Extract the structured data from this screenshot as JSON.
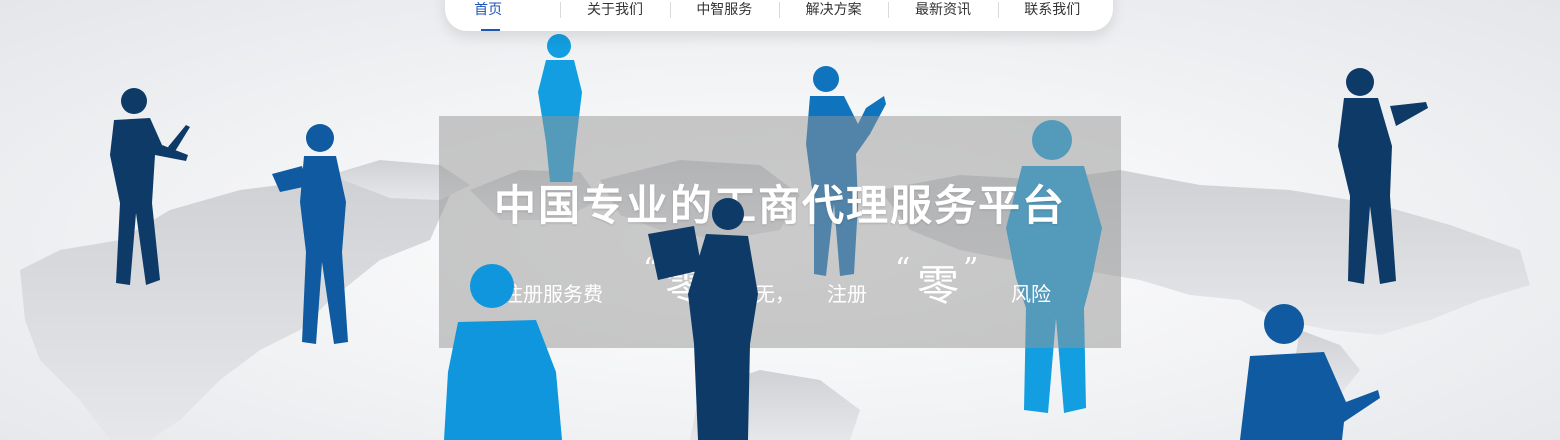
{
  "nav": {
    "items": [
      {
        "label": "首页",
        "active": true
      },
      {
        "label": "关于我们",
        "active": false
      },
      {
        "label": "中智服务",
        "active": false
      },
      {
        "label": "解决方案",
        "active": false
      },
      {
        "label": "最新资讯",
        "active": false
      },
      {
        "label": "联系我们",
        "active": false
      }
    ]
  },
  "hero": {
    "title": "中国专业的工商代理服务平台",
    "subtitle": {
      "part1": "注册服务费",
      "quote_open_1": "“",
      "zero1": "零",
      "quote_close_1": "”",
      "part2": "无，",
      "part3": "注册",
      "quote_open_2": "“",
      "zero2": "零",
      "quote_close_2": "”",
      "part4": "风险"
    }
  },
  "colors": {
    "accent": "#1d56b7",
    "silhouette_dark": "#0d3a66",
    "silhouette_mid": "#0f63b0",
    "silhouette_light": "#129ee0",
    "map_gray": "#c9cbd0"
  }
}
